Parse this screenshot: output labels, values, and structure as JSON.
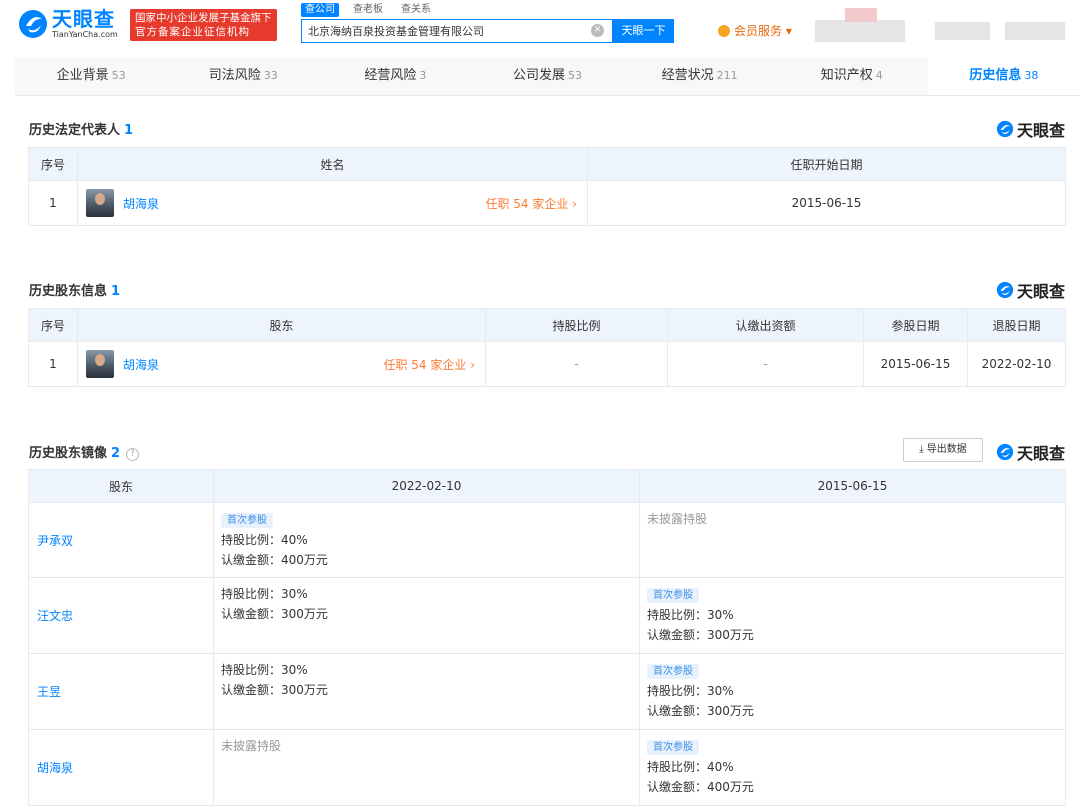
{
  "header": {
    "logo_cn": "天眼查",
    "logo_en": "TianYanCha.com",
    "badge_line1": "国家中小企业发展子基金旗下",
    "badge_line2": "官方备案企业征信机构",
    "search_tabs": [
      "查公司",
      "查老板",
      "查关系"
    ],
    "search_value": "北京海纳百泉投资基金管理有限公司",
    "search_button": "天眼一下",
    "vip_label": "会员服务 ▾"
  },
  "tabs": [
    {
      "label": "企业背景",
      "count": "53"
    },
    {
      "label": "司法风险",
      "count": "33"
    },
    {
      "label": "经营风险",
      "count": "3"
    },
    {
      "label": "公司发展",
      "count": "53"
    },
    {
      "label": "经营状况",
      "count": "211"
    },
    {
      "label": "知识产权",
      "count": "4"
    },
    {
      "label": "历史信息",
      "count": "38"
    }
  ],
  "brand": "天眼查",
  "legal_rep": {
    "title": "历史法定代表人",
    "count": "1",
    "headers": [
      "序号",
      "姓名",
      "任职开始日期"
    ],
    "rows": [
      {
        "idx": "1",
        "name": "胡海泉",
        "link": "任职 54 家企业 ›",
        "start": "2015-06-15"
      }
    ]
  },
  "shareholders": {
    "title": "历史股东信息",
    "count": "1",
    "headers": [
      "序号",
      "股东",
      "持股比例",
      "认缴出资额",
      "参股日期",
      "退股日期"
    ],
    "rows": [
      {
        "idx": "1",
        "name": "胡海泉",
        "link": "任职 54 家企业 ›",
        "ratio": "-",
        "amount": "-",
        "join": "2015-06-15",
        "exit": "2022-02-10"
      }
    ]
  },
  "mirror": {
    "title": "历史股东镜像",
    "count": "2",
    "help": "?",
    "export": "导出数据",
    "headers": [
      "股东",
      "2022-02-10",
      "2015-06-15"
    ],
    "rows": [
      {
        "name": "尹承双",
        "a": {
          "badge": "首次参股",
          "ratio": "持股比例：40%",
          "amount": "认缴金额：400万元",
          "none": ""
        },
        "b": {
          "badge": "",
          "ratio": "",
          "amount": "",
          "none": "未披露持股"
        }
      },
      {
        "name": "汪文忠",
        "a": {
          "badge": "",
          "ratio": "持股比例：30%",
          "amount": "认缴金额：300万元",
          "none": ""
        },
        "b": {
          "badge": "首次参股",
          "ratio": "持股比例：30%",
          "amount": "认缴金额：300万元",
          "none": ""
        }
      },
      {
        "name": "王昱",
        "a": {
          "badge": "",
          "ratio": "持股比例：30%",
          "amount": "认缴金额：300万元",
          "none": ""
        },
        "b": {
          "badge": "首次参股",
          "ratio": "持股比例：30%",
          "amount": "认缴金额：300万元",
          "none": ""
        }
      },
      {
        "name": "胡海泉",
        "a": {
          "badge": "",
          "ratio": "",
          "amount": "",
          "none": "未披露持股"
        },
        "b": {
          "badge": "首次参股",
          "ratio": "持股比例：40%",
          "amount": "认缴金额：400万元",
          "none": ""
        }
      }
    ]
  }
}
